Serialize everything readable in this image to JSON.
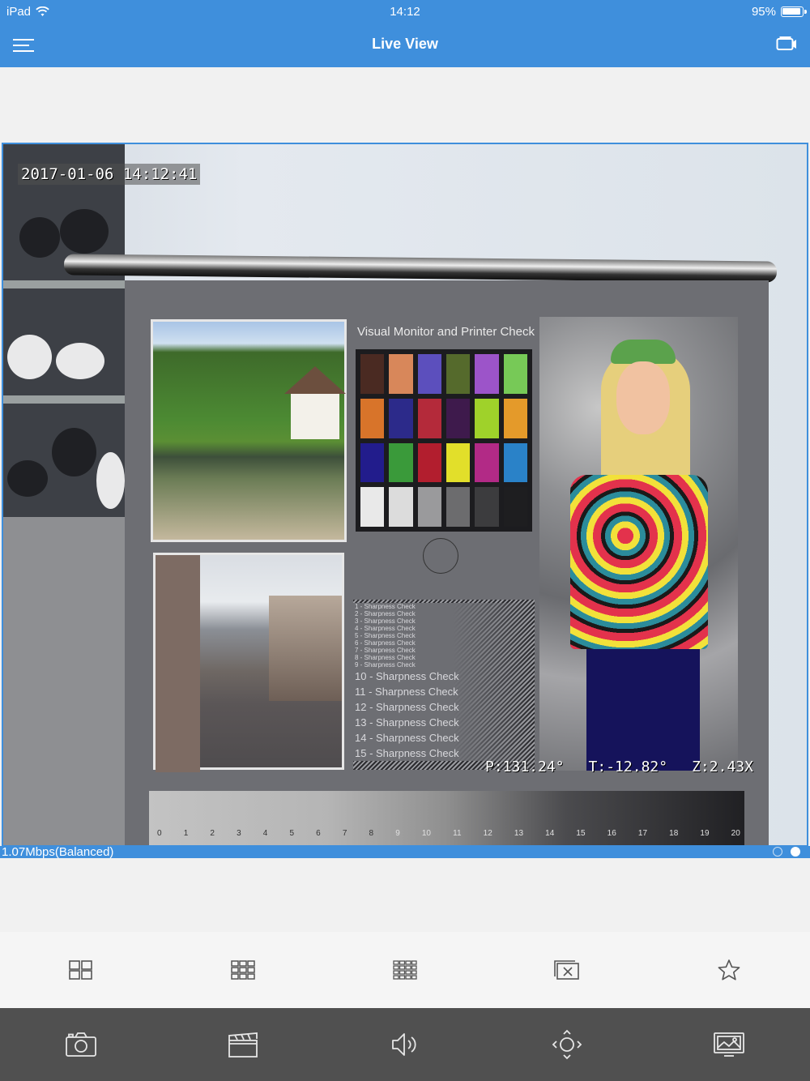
{
  "status_bar": {
    "carrier": "iPad",
    "time": "14:12",
    "battery": "95%"
  },
  "nav": {
    "title": "Live View",
    "left_icon": "menu-icon",
    "right_icon": "camera-switch-icon"
  },
  "video": {
    "osd_timestamp": "2017-01-06 14:12:41",
    "osd_pan": "P:131.24°",
    "osd_tilt": "T:-12.82°",
    "osd_zoom": "Z:2.43X",
    "chart_title": "Visual Monitor and Printer Check",
    "sharpness_checks": [
      "1 - Sharpness Check",
      "2 - Sharpness Check",
      "3 - Sharpness Check",
      "4 - Sharpness Check",
      "5 - Sharpness Check",
      "6 - Sharpness Check",
      "7 - Sharpness Check",
      "8 - Sharpness Check",
      "9 - Sharpness Check",
      "10 - Sharpness Check",
      "11 - Sharpness Check",
      "12 - Sharpness Check",
      "13 - Sharpness Check",
      "14 - Sharpness Check",
      "15 - Sharpness Check"
    ],
    "grayscale_numbers": [
      "0",
      "1",
      "2",
      "3",
      "4",
      "5",
      "6",
      "7",
      "8",
      "9",
      "10",
      "11",
      "12",
      "13",
      "14",
      "15",
      "16",
      "17",
      "18",
      "19",
      "20"
    ],
    "swatch_colors": [
      "#4a2a22",
      "#d8875a",
      "#5c4fbd",
      "#556a2c",
      "#9c54c9",
      "#77c957",
      "#d8742a",
      "#2c2a8a",
      "#b42a3a",
      "#3e1a4c",
      "#9fd22a",
      "#e49a2a",
      "#221c8c",
      "#3a9a3a",
      "#b21e2e",
      "#e2df2a",
      "#b22a86",
      "#2a82c8",
      "#e9e9e9",
      "#dcdcdc",
      "#9a9a9c",
      "#6c6c6e",
      "#3c3c3e",
      "#1e1e20"
    ]
  },
  "stream": {
    "bitrate": "1.07Mbps(Balanced)"
  },
  "layout_toolbar": [
    {
      "name": "layout-4-icon"
    },
    {
      "name": "layout-9-icon"
    },
    {
      "name": "layout-16-icon"
    },
    {
      "name": "close-all-icon"
    },
    {
      "name": "favorite-star-icon"
    }
  ],
  "bottom_toolbar": [
    {
      "name": "snapshot-camera-icon"
    },
    {
      "name": "record-clapper-icon"
    },
    {
      "name": "audio-speaker-icon"
    },
    {
      "name": "ptz-control-icon"
    },
    {
      "name": "image-settings-icon"
    }
  ],
  "colors": {
    "accent": "#3f8fdc",
    "bottom_bar": "#505050",
    "background": "#f1f1f1"
  }
}
